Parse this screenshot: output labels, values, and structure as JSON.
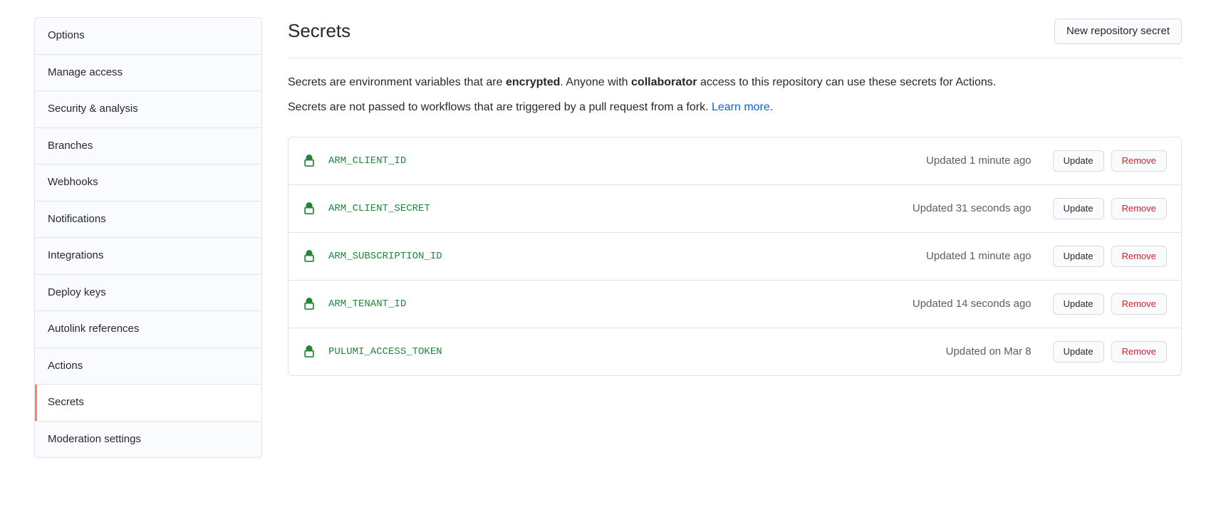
{
  "sidebar": {
    "items": [
      {
        "label": "Options",
        "id": "options"
      },
      {
        "label": "Manage access",
        "id": "manage-access"
      },
      {
        "label": "Security & analysis",
        "id": "security-analysis"
      },
      {
        "label": "Branches",
        "id": "branches"
      },
      {
        "label": "Webhooks",
        "id": "webhooks"
      },
      {
        "label": "Notifications",
        "id": "notifications"
      },
      {
        "label": "Integrations",
        "id": "integrations"
      },
      {
        "label": "Deploy keys",
        "id": "deploy-keys"
      },
      {
        "label": "Autolink references",
        "id": "autolink-references"
      },
      {
        "label": "Actions",
        "id": "actions"
      },
      {
        "label": "Secrets",
        "id": "secrets",
        "active": true
      },
      {
        "label": "Moderation settings",
        "id": "moderation-settings"
      }
    ]
  },
  "header": {
    "title": "Secrets",
    "new_button": "New repository secret"
  },
  "description": {
    "part1": "Secrets are environment variables that are ",
    "strong1": "encrypted",
    "part2": ". Anyone with ",
    "strong2": "collaborator",
    "part3": " access to this repository can use these secrets for Actions.",
    "line2": "Secrets are not passed to workflows that are triggered by a pull request from a fork. ",
    "learn_more": "Learn more",
    "period": "."
  },
  "secrets": [
    {
      "name": "ARM_CLIENT_ID",
      "updated": "Updated 1 minute ago"
    },
    {
      "name": "ARM_CLIENT_SECRET",
      "updated": "Updated 31 seconds ago"
    },
    {
      "name": "ARM_SUBSCRIPTION_ID",
      "updated": "Updated 1 minute ago"
    },
    {
      "name": "ARM_TENANT_ID",
      "updated": "Updated 14 seconds ago"
    },
    {
      "name": "PULUMI_ACCESS_TOKEN",
      "updated": "Updated on Mar 8"
    }
  ],
  "buttons": {
    "update": "Update",
    "remove": "Remove"
  }
}
